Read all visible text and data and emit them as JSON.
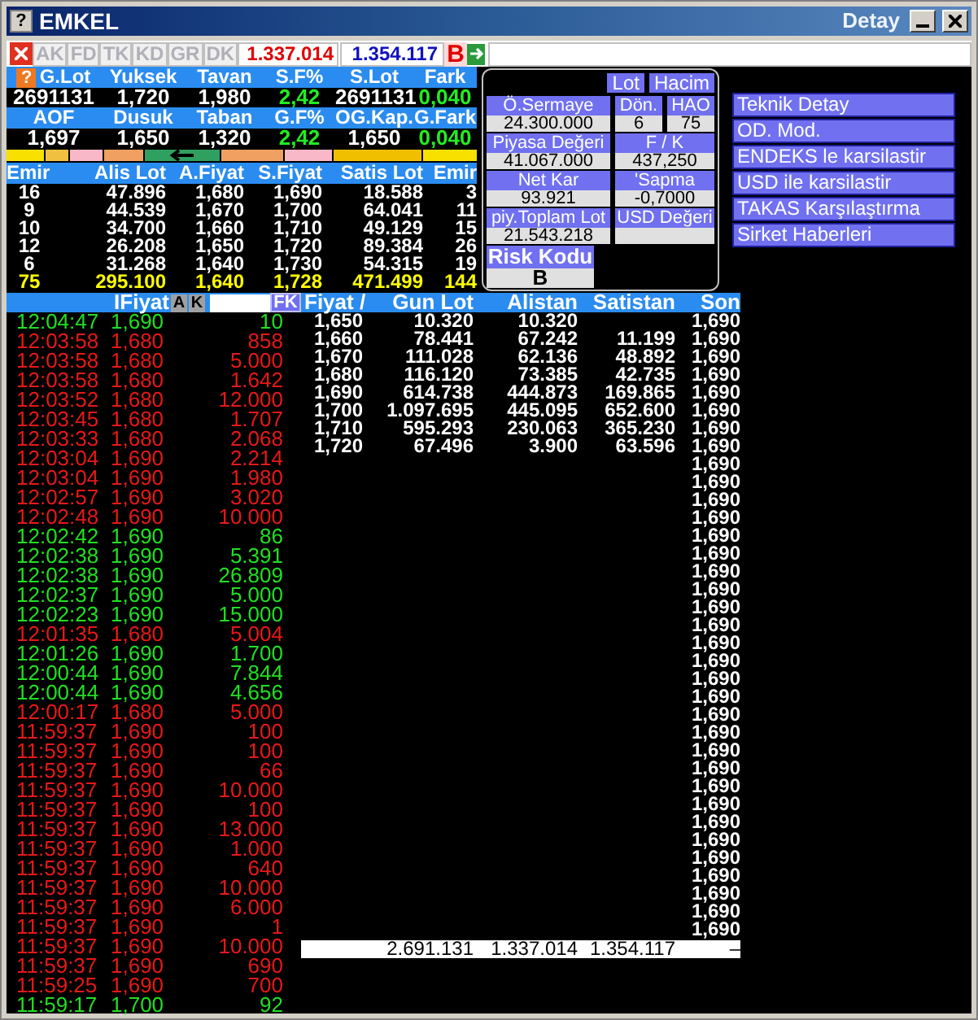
{
  "window": {
    "title": "EMKEL",
    "subtitle": "Detay",
    "help_glyph": "?"
  },
  "toolbar": {
    "tabs": [
      {
        "label": "AK",
        "disabled": true
      },
      {
        "label": "FD",
        "disabled": true
      },
      {
        "label": "TK",
        "disabled": true
      },
      {
        "label": "KD",
        "disabled": true
      },
      {
        "label": "GR",
        "disabled": true
      },
      {
        "label": "DK",
        "disabled": true
      }
    ],
    "sell_total": "1.337.014",
    "buy_total": "1.354.117",
    "flag": "B"
  },
  "stats": {
    "help_glyph": "?",
    "rows": [
      {
        "headers": [
          "G.Lot",
          "Yuksek",
          "Tavan",
          "S.F%",
          "S.Lot",
          "Fark"
        ],
        "values": [
          {
            "text": "2691131",
            "highlighted": false
          },
          {
            "text": "1,720",
            "highlighted": false
          },
          {
            "text": "1,980",
            "highlighted": false
          },
          {
            "text": "2,42",
            "highlighted": true
          },
          {
            "text": "2691131",
            "highlighted": false
          },
          {
            "text": "0,040",
            "highlighted": true
          }
        ]
      },
      {
        "headers": [
          "AOF",
          "Dusuk",
          "Taban",
          "G.F%",
          "OG.Kap.",
          "G.Fark"
        ],
        "values": [
          {
            "text": "1,697",
            "highlighted": false
          },
          {
            "text": "1,650",
            "highlighted": false
          },
          {
            "text": "1,320",
            "highlighted": false
          },
          {
            "text": "2,42",
            "highlighted": true
          },
          {
            "text": "1,650",
            "highlighted": false
          },
          {
            "text": "0,040",
            "highlighted": true
          }
        ]
      }
    ]
  },
  "depth": {
    "columns": [
      "Emir",
      "Alis Lot",
      "A.Fiyat",
      "S.Fiyat",
      "Satis Lot",
      "Emir"
    ],
    "rows": [
      [
        "16",
        "47.896",
        "1,680",
        "1,690",
        "18.588",
        "3"
      ],
      [
        "9",
        "44.539",
        "1,670",
        "1,700",
        "64.041",
        "11"
      ],
      [
        "10",
        "34.700",
        "1,660",
        "1,710",
        "49.129",
        "15"
      ],
      [
        "12",
        "26.208",
        "1,650",
        "1,720",
        "89.384",
        "26"
      ],
      [
        "6",
        "31.268",
        "1,640",
        "1,730",
        "54.315",
        "19"
      ]
    ],
    "totals": [
      "75",
      "295.100",
      "1,640",
      "1,728",
      "471.499",
      "144"
    ]
  },
  "info_panel": {
    "toggles": [
      "Lot",
      "Hacim"
    ],
    "field_rows": [
      [
        {
          "label": "Ö.Sermaye",
          "value": "24.300.000"
        },
        {
          "label": "Dön.",
          "value": "6"
        },
        {
          "label": "HAO",
          "value": "75"
        }
      ],
      [
        {
          "label": "Piyasa Değeri",
          "value": "41.067.000"
        },
        {
          "label": "F / K",
          "value": "437,250"
        }
      ],
      [
        {
          "label": "Net Kar",
          "value": "93.921"
        },
        {
          "label": "'Sapma",
          "value": "-0,7000"
        }
      ],
      [
        {
          "label": "piy.Toplam Lot",
          "value": "21.543.218"
        },
        {
          "label": "USD Değeri"
        }
      ]
    ],
    "risk": {
      "label": "Risk Kodu",
      "value": "B"
    }
  },
  "links": [
    "Teknik Detay",
    "OD. Mod.",
    "ENDEKS le karsilastir",
    "USD ile karsilastir",
    "TAKAS Karşılaştırma",
    "Sirket Haberleri"
  ],
  "trades": {
    "header": "IFiyat",
    "buttons": [
      "A",
      "K"
    ],
    "filter_button": "FK",
    "rows": [
      {
        "time": "12:04:47",
        "price": "1,690",
        "lot": "10",
        "uptick": true
      },
      {
        "time": "12:03:58",
        "price": "1,680",
        "lot": "858",
        "uptick": false
      },
      {
        "time": "12:03:58",
        "price": "1,680",
        "lot": "5.000",
        "uptick": false
      },
      {
        "time": "12:03:58",
        "price": "1,680",
        "lot": "1.642",
        "uptick": false
      },
      {
        "time": "12:03:52",
        "price": "1,680",
        "lot": "12.000",
        "uptick": false
      },
      {
        "time": "12:03:45",
        "price": "1,680",
        "lot": "1.707",
        "uptick": false
      },
      {
        "time": "12:03:33",
        "price": "1,680",
        "lot": "2.068",
        "uptick": false
      },
      {
        "time": "12:03:04",
        "price": "1,690",
        "lot": "2.214",
        "uptick": false
      },
      {
        "time": "12:03:04",
        "price": "1,690",
        "lot": "1.980",
        "uptick": false
      },
      {
        "time": "12:02:57",
        "price": "1,690",
        "lot": "3.020",
        "uptick": false
      },
      {
        "time": "12:02:48",
        "price": "1,690",
        "lot": "10.000",
        "uptick": false
      },
      {
        "time": "12:02:42",
        "price": "1,690",
        "lot": "86",
        "uptick": true
      },
      {
        "time": "12:02:38",
        "price": "1,690",
        "lot": "5.391",
        "uptick": true
      },
      {
        "time": "12:02:38",
        "price": "1,690",
        "lot": "26.809",
        "uptick": true
      },
      {
        "time": "12:02:37",
        "price": "1,690",
        "lot": "5.000",
        "uptick": true
      },
      {
        "time": "12:02:23",
        "price": "1,690",
        "lot": "15.000",
        "uptick": true
      },
      {
        "time": "12:01:35",
        "price": "1,680",
        "lot": "5.004",
        "uptick": false
      },
      {
        "time": "12:01:26",
        "price": "1,690",
        "lot": "1.700",
        "uptick": true
      },
      {
        "time": "12:00:44",
        "price": "1,690",
        "lot": "7.844",
        "uptick": true
      },
      {
        "time": "12:00:44",
        "price": "1,690",
        "lot": "4.656",
        "uptick": true
      },
      {
        "time": "12:00:17",
        "price": "1,680",
        "lot": "5.000",
        "uptick": false
      },
      {
        "time": "11:59:37",
        "price": "1,690",
        "lot": "100",
        "uptick": false
      },
      {
        "time": "11:59:37",
        "price": "1,690",
        "lot": "100",
        "uptick": false
      },
      {
        "time": "11:59:37",
        "price": "1,690",
        "lot": "66",
        "uptick": false
      },
      {
        "time": "11:59:37",
        "price": "1,690",
        "lot": "10.000",
        "uptick": false
      },
      {
        "time": "11:59:37",
        "price": "1,690",
        "lot": "100",
        "uptick": false
      },
      {
        "time": "11:59:37",
        "price": "1,690",
        "lot": "13.000",
        "uptick": false
      },
      {
        "time": "11:59:37",
        "price": "1,690",
        "lot": "1.000",
        "uptick": false
      },
      {
        "time": "11:59:37",
        "price": "1,690",
        "lot": "640",
        "uptick": false
      },
      {
        "time": "11:59:37",
        "price": "1,690",
        "lot": "10.000",
        "uptick": false
      },
      {
        "time": "11:59:37",
        "price": "1,690",
        "lot": "6.000",
        "uptick": false
      },
      {
        "time": "11:59:37",
        "price": "1,690",
        "lot": "1",
        "uptick": false
      },
      {
        "time": "11:59:37",
        "price": "1,690",
        "lot": "10.000",
        "uptick": false
      },
      {
        "time": "11:59:37",
        "price": "1,690",
        "lot": "690",
        "uptick": false
      },
      {
        "time": "11:59:25",
        "price": "1,690",
        "lot": "700",
        "uptick": false
      },
      {
        "time": "11:59:17",
        "price": "1,700",
        "lot": "92",
        "uptick": true
      }
    ]
  },
  "price_table": {
    "columns": [
      "Fiyat /",
      "Gun Lot",
      "Alistan",
      "Satistan",
      "Son"
    ],
    "rows": [
      {
        "fiyat": "1,650",
        "gun_lot": "10.320",
        "alistan": "10.320",
        "son": "1,690"
      },
      {
        "fiyat": "1,660",
        "gun_lot": "78.441",
        "alistan": "67.242",
        "satistan": "11.199",
        "son": "1,690"
      },
      {
        "fiyat": "1,670",
        "gun_lot": "111.028",
        "alistan": "62.136",
        "satistan": "48.892",
        "son": "1,690"
      },
      {
        "fiyat": "1,680",
        "gun_lot": "116.120",
        "alistan": "73.385",
        "satistan": "42.735",
        "son": "1,690"
      },
      {
        "fiyat": "1,690",
        "gun_lot": "614.738",
        "alistan": "444.873",
        "satistan": "169.865",
        "son": "1,690"
      },
      {
        "fiyat": "1,700",
        "gun_lot": "1.097.695",
        "alistan": "445.095",
        "satistan": "652.600",
        "son": "1,690"
      },
      {
        "fiyat": "1,710",
        "gun_lot": "595.293",
        "alistan": "230.063",
        "satistan": "365.230",
        "son": "1,690"
      },
      {
        "fiyat": "1,720",
        "gun_lot": "67.496",
        "alistan": "3.900",
        "satistan": "63.596",
        "son": "1,690"
      },
      {
        "son": "1,690"
      },
      {
        "son": "1,690"
      },
      {
        "son": "1,690"
      },
      {
        "son": "1,690"
      },
      {
        "son": "1,690"
      },
      {
        "son": "1,690"
      },
      {
        "son": "1,690"
      },
      {
        "son": "1,690"
      },
      {
        "son": "1,690"
      },
      {
        "son": "1,690"
      },
      {
        "son": "1,690"
      },
      {
        "son": "1,690"
      },
      {
        "son": "1,690"
      },
      {
        "son": "1,690"
      },
      {
        "son": "1,690"
      },
      {
        "son": "1,690"
      },
      {
        "son": "1,690"
      },
      {
        "son": "1,690"
      },
      {
        "son": "1,690"
      },
      {
        "son": "1,690"
      },
      {
        "son": "1,690"
      },
      {
        "son": "1,690"
      },
      {
        "son": "1,690"
      },
      {
        "son": "1,690"
      },
      {
        "son": "1,690"
      },
      {
        "son": "1,690"
      },
      {
        "son": "1,690"
      }
    ],
    "footer": {
      "gun_lot": "2.691.131",
      "alistan": "1.337.014",
      "satistan": "1.354.117",
      "son": "–"
    }
  }
}
